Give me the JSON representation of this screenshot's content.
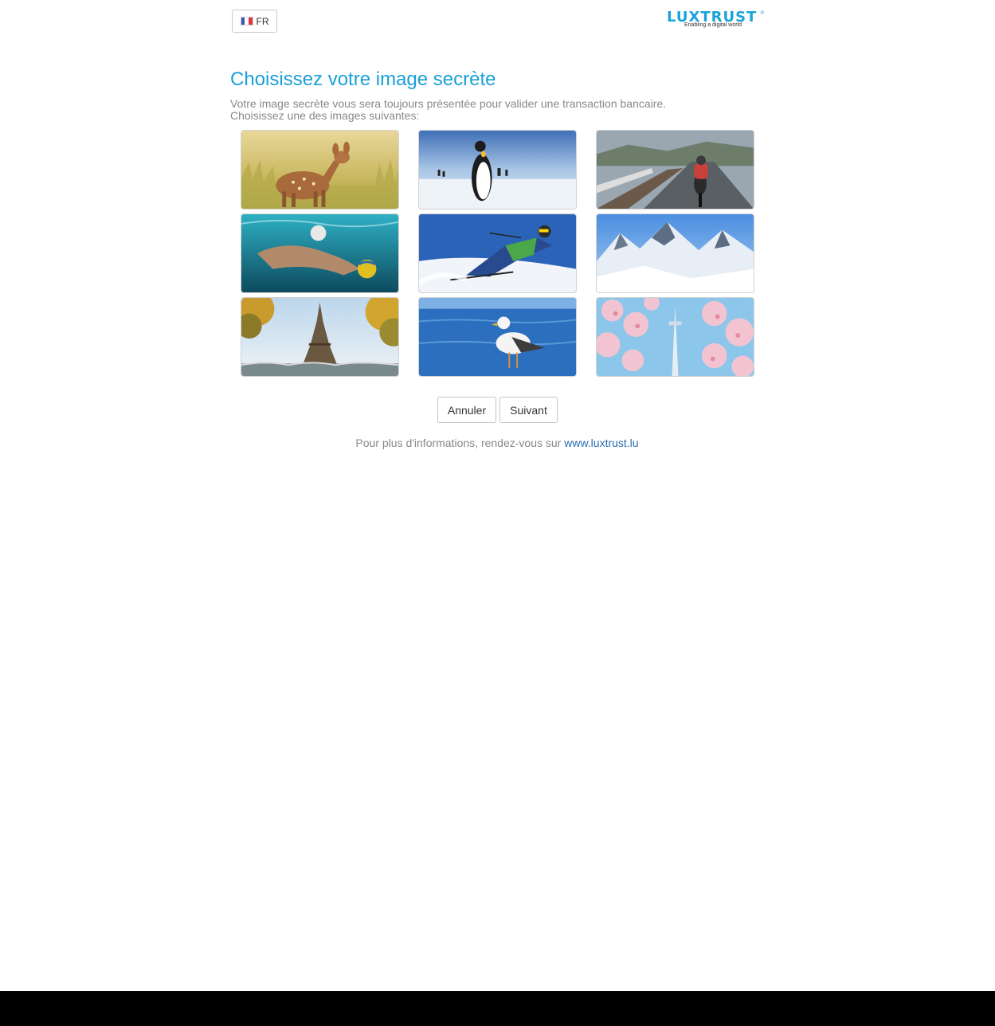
{
  "header": {
    "language": {
      "code": "FR",
      "flag_icon": "france-flag-icon"
    },
    "logo": {
      "wordmark": "LUXTRUST",
      "tagline": "Enabling a digital world",
      "registered": "®",
      "color": "#1aa3d9"
    }
  },
  "main": {
    "title": "Choisissez votre image secrète",
    "description_line1": "Votre image secrète vous sera toujours présentée pour valider une transaction bancaire.",
    "description_line2": "Choisissez une des images suivantes:",
    "images": [
      {
        "subject": "fawn-in-grass"
      },
      {
        "subject": "penguins-on-ice"
      },
      {
        "subject": "cyclist-on-road"
      },
      {
        "subject": "water-polo-swimmer"
      },
      {
        "subject": "downhill-skier"
      },
      {
        "subject": "snowy-mountains"
      },
      {
        "subject": "eiffel-tower"
      },
      {
        "subject": "seagull-by-sea"
      },
      {
        "subject": "cherry-blossom-tower"
      }
    ]
  },
  "actions": {
    "cancel_label": "Annuler",
    "next_label": "Suivant"
  },
  "footer": {
    "text": "Pour plus d'informations, rendez-vous sur ",
    "link_text": "www.luxtrust.lu"
  },
  "colors": {
    "title": "#1a9fd8",
    "link": "#2a6fb0",
    "muted_text": "#888888",
    "taskbar": "#000000"
  }
}
